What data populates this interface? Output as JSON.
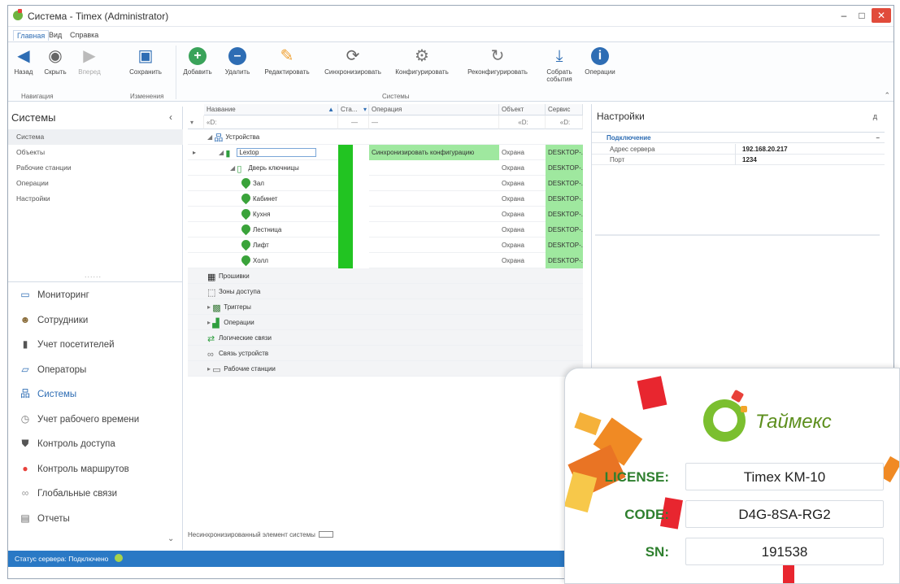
{
  "window": {
    "title": "Система - Timex (Administrator)"
  },
  "menu": [
    "Главная",
    "Вид",
    "Справка"
  ],
  "ribbon": {
    "back": "Назад",
    "hide": "Скрыть",
    "forward": "Вперед",
    "save": "Сохранить",
    "add": "Добавить",
    "delete": "Удалить",
    "edit": "Редактировать",
    "sync": "Синхронизировать",
    "configure": "Конфигурировать",
    "reconfigure": "Реконфигурировать",
    "collect_events": "Собрать события",
    "operations": "Операции",
    "group_nav": "Навигация",
    "group_changes": "Изменения",
    "group_systems": "Системы"
  },
  "left_panel": {
    "title": "Системы",
    "items": [
      "Система",
      "Объекты",
      "Рабочие станции",
      "Операции",
      "Настройки"
    ],
    "grip": "......",
    "nav": [
      {
        "label": "Мониторинг",
        "icon": "monitor-icon"
      },
      {
        "label": "Сотрудники",
        "icon": "people-icon"
      },
      {
        "label": "Учет посетителей",
        "icon": "visitor-icon"
      },
      {
        "label": "Операторы",
        "icon": "operator-icon"
      },
      {
        "label": "Системы",
        "icon": "system-icon"
      },
      {
        "label": "Учет рабочего времени",
        "icon": "clock-icon"
      },
      {
        "label": "Контроль доступа",
        "icon": "shield-icon"
      },
      {
        "label": "Контроль маршрутов",
        "icon": "pin-icon"
      },
      {
        "label": "Глобальные связи",
        "icon": "link-icon"
      },
      {
        "label": "Отчеты",
        "icon": "report-icon"
      }
    ]
  },
  "grid": {
    "columns": [
      "Название",
      "Ста...",
      "Операция",
      "Объект",
      "Сервис"
    ],
    "filter": "«D:",
    "filter_dash": "—",
    "rows": [
      {
        "name": "Устройства",
        "level": 0,
        "icon": "devices",
        "status": false,
        "operation": "",
        "object": "",
        "service": ""
      },
      {
        "name": "Lextop",
        "level": 1,
        "icon": "controller",
        "status": true,
        "operation": "Синхронизировать конфигурацию",
        "object": "Охрана",
        "service": "DESKTOP-..."
      },
      {
        "name": "Дверь ключницы",
        "level": 2,
        "icon": "door",
        "status": true,
        "operation": "",
        "object": "Охрана",
        "service": "DESKTOP-..."
      },
      {
        "name": "Зал",
        "level": 3,
        "icon": "key",
        "status": true,
        "operation": "",
        "object": "Охрана",
        "service": "DESKTOP-..."
      },
      {
        "name": "Кабинет",
        "level": 3,
        "icon": "key",
        "status": true,
        "operation": "",
        "object": "Охрана",
        "service": "DESKTOP-..."
      },
      {
        "name": "Кухня",
        "level": 3,
        "icon": "key",
        "status": true,
        "operation": "",
        "object": "Охрана",
        "service": "DESKTOP-..."
      },
      {
        "name": "Лестница",
        "level": 3,
        "icon": "key",
        "status": true,
        "operation": "",
        "object": "Охрана",
        "service": "DESKTOP-..."
      },
      {
        "name": "Лифт",
        "level": 3,
        "icon": "key",
        "status": true,
        "operation": "",
        "object": "Охрана",
        "service": "DESKTOP-..."
      },
      {
        "name": "Холл",
        "level": 3,
        "icon": "key",
        "status": true,
        "operation": "",
        "object": "Охрана",
        "service": "DESKTOP-..."
      },
      {
        "name": "Прошивки",
        "level": 0,
        "icon": "chip",
        "status": false,
        "operation": "",
        "object": "",
        "service": ""
      },
      {
        "name": "Зоны доступа",
        "level": 0,
        "icon": "zone",
        "status": false,
        "operation": "",
        "object": "",
        "service": ""
      },
      {
        "name": "Триггеры",
        "level": 0,
        "icon": "trigger",
        "status": false,
        "operation": "",
        "object": "",
        "service": ""
      },
      {
        "name": "Операции",
        "level": 0,
        "icon": "ops",
        "status": false,
        "operation": "",
        "object": "",
        "service": ""
      },
      {
        "name": "Логические связи",
        "level": 0,
        "icon": "logic",
        "status": false,
        "operation": "",
        "object": "",
        "service": ""
      },
      {
        "name": "Связь устройств",
        "level": 0,
        "icon": "link",
        "status": false,
        "operation": "",
        "object": "",
        "service": ""
      },
      {
        "name": "Рабочие станции",
        "level": 0,
        "icon": "workstation",
        "status": false,
        "operation": "",
        "object": "",
        "service": ""
      }
    ],
    "footer": "Несинхронизированный элемент системы"
  },
  "settings": {
    "title": "Настройки",
    "pin": "д",
    "group": "Подключение",
    "props": [
      {
        "key": "Адрес сервера",
        "value": "192.168.20.217"
      },
      {
        "key": "Порт",
        "value": "1234"
      }
    ]
  },
  "status_bar": "Статус сервера: Подключено",
  "license_card": {
    "brand": "Таймекс",
    "license_label": "LICENSE:",
    "license_value": "Timex KM-10",
    "code_label": "CODE:",
    "code_value": "D4G-8SA-RG2",
    "sn_label": "SN:",
    "sn_value": "191538"
  },
  "colors": {
    "accent": "#2e6db4",
    "status_green": "#3fd73f",
    "light_green": "#9fe89f",
    "status_bar": "#2a79c5",
    "brand_green": "#5d8f1e"
  }
}
